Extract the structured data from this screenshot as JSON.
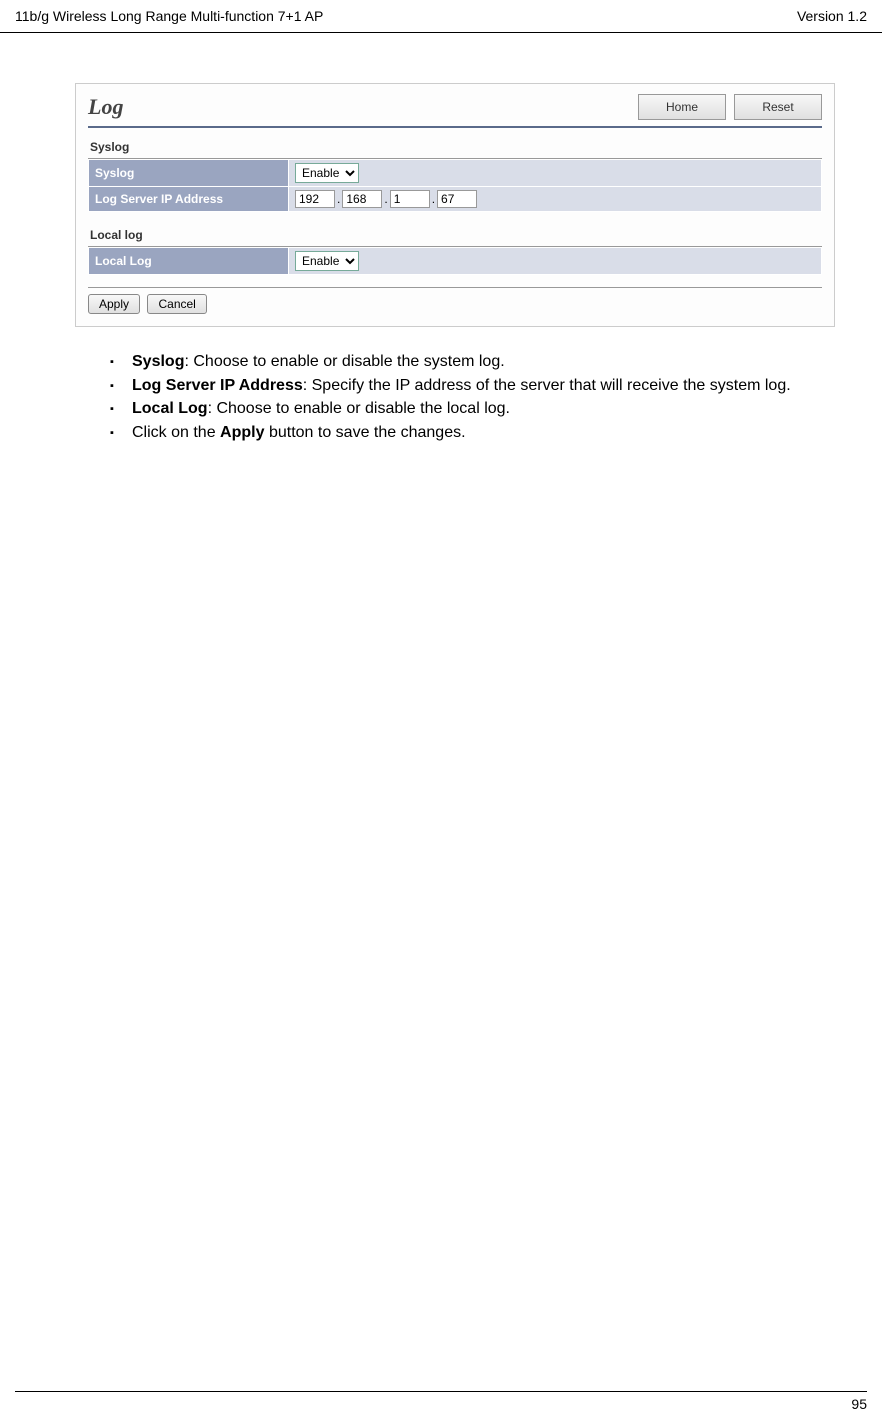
{
  "header": {
    "left": "11b/g Wireless Long Range Multi-function 7+1 AP",
    "right": "Version 1.2"
  },
  "screenshot": {
    "title": "Log",
    "homeBtn": "Home",
    "resetBtn": "Reset",
    "syslogSection": "Syslog",
    "syslogLabel": "Syslog",
    "syslogValue": "Enable",
    "ipLabel": "Log Server IP Address",
    "ip1": "192",
    "ip2": "168",
    "ip3": "1",
    "ip4": "67",
    "localSection": "Local log",
    "localLabel": "Local Log",
    "localValue": "Enable",
    "applyBtn": "Apply",
    "cancelBtn": "Cancel"
  },
  "bullets": {
    "b1_bold": "Syslog",
    "b1_rest": ": Choose to enable or disable the system log.",
    "b2_bold": "Log Server IP Address",
    "b2_rest": ": Specify the IP address of the server that will receive the system log.",
    "b3_bold": "Local Log",
    "b3_rest": ": Choose to enable or disable the local log.",
    "b4_pre": "Click on the ",
    "b4_bold": "Apply",
    "b4_post": " button to save the changes."
  },
  "footer": {
    "pageNum": "95"
  }
}
